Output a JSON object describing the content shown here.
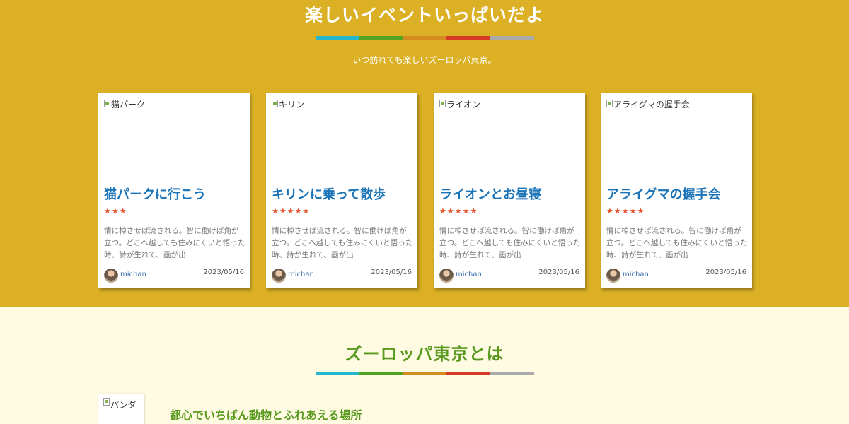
{
  "events": {
    "title": "楽しいイベントいっぱいだよ",
    "subtitle": "いつ訪れても楽しいズーロッパ東京。",
    "divider_colors": [
      "#22b7cf",
      "#52a31f",
      "#d48b1f",
      "#d63a26",
      "#aaaaaa"
    ],
    "cards": [
      {
        "image_alt": "猫パーク",
        "title": "猫パークに行こう",
        "rating": 3,
        "stars": "★★★",
        "text": "情に棹させば流される。智に働けば角が立つ。どこへ越しても住みにくいと悟った時、詩が生れて、画が出",
        "author": "michan",
        "date": "2023/05/16"
      },
      {
        "image_alt": "キリン",
        "title": "キリンに乗って散歩",
        "rating": 5,
        "stars": "★★★★★",
        "text": "情に棹させば流される。智に働けば角が立つ。どこへ越しても住みにくいと悟った時、詩が生れて、画が出",
        "author": "michan",
        "date": "2023/05/16"
      },
      {
        "image_alt": "ライオン",
        "title": "ライオンとお昼寝",
        "rating": 5,
        "stars": "★★★★★",
        "text": "情に棹させば流される。智に働けば角が立つ。どこへ越しても住みにくいと悟った時、詩が生れて、画が出",
        "author": "michan",
        "date": "2023/05/16"
      },
      {
        "image_alt": "アライグマの握手会",
        "title": "アライグマの握手会",
        "rating": 5,
        "stars": "★★★★★",
        "text": "情に棹させば流される。智に働けば角が立つ。どこへ越しても住みにくいと悟った時、詩が生れて、画が出",
        "author": "michan",
        "date": "2023/05/16"
      }
    ]
  },
  "about": {
    "title": "ズーロッパ東京とは",
    "image_alt": "パンダ",
    "subtitle": "都心でいちばん動物とふれあえる場所"
  },
  "colors": {
    "events_background": "#dbb025",
    "about_background": "#fffbe3",
    "card_title": "#1b74b8",
    "star": "#e54f2a",
    "about_heading": "#5a9a1f"
  }
}
